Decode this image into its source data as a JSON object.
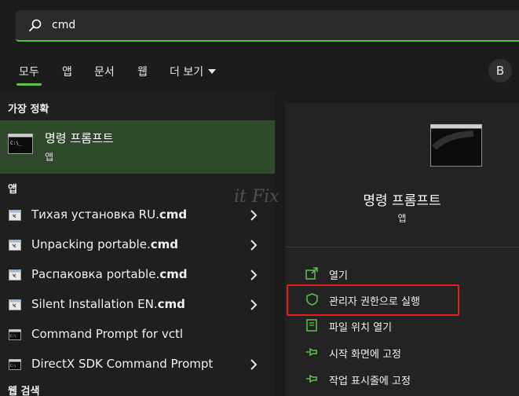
{
  "search": {
    "query": "cmd"
  },
  "tabs": [
    {
      "label": "모두"
    },
    {
      "label": "앱"
    },
    {
      "label": "문서"
    },
    {
      "label": "웹"
    },
    {
      "label": "더 보기"
    }
  ],
  "avatar": {
    "initial": "B"
  },
  "best_match": {
    "header": "가장 정확",
    "title": "명령 프롬프트",
    "subtitle": "앱"
  },
  "apps": {
    "header": "앱",
    "items": [
      {
        "label_plain": "Тихая установка RU.",
        "label_bold": "cmd"
      },
      {
        "label_plain": "Unpacking portable.",
        "label_bold": "cmd"
      },
      {
        "label_plain": "Распаковка portable.",
        "label_bold": "cmd"
      },
      {
        "label_plain": "Silent Installation EN.",
        "label_bold": "cmd"
      },
      {
        "label_plain": "Command Prompt for vctl",
        "label_bold": ""
      },
      {
        "label_plain": "DirectX SDK Command Prompt",
        "label_bold": ""
      }
    ]
  },
  "web_search": {
    "header": "웹 검색"
  },
  "preview": {
    "title": "명령 프롬프트",
    "subtitle": "앱",
    "actions": [
      {
        "label": "열기",
        "icon": "open-icon"
      },
      {
        "label": "관리자 권한으로 실행",
        "icon": "shield-icon"
      },
      {
        "label": "파일 위치 열기",
        "icon": "folder-icon"
      },
      {
        "label": "시작 화면에 고정",
        "icon": "pin-icon"
      },
      {
        "label": "작업 표시줄에 고정",
        "icon": "pin-icon"
      }
    ]
  },
  "watermark": "it Fix",
  "colors": {
    "accent": "#5ec24b",
    "highlight": "#e02020",
    "selected_row": "#2e4a2b"
  }
}
